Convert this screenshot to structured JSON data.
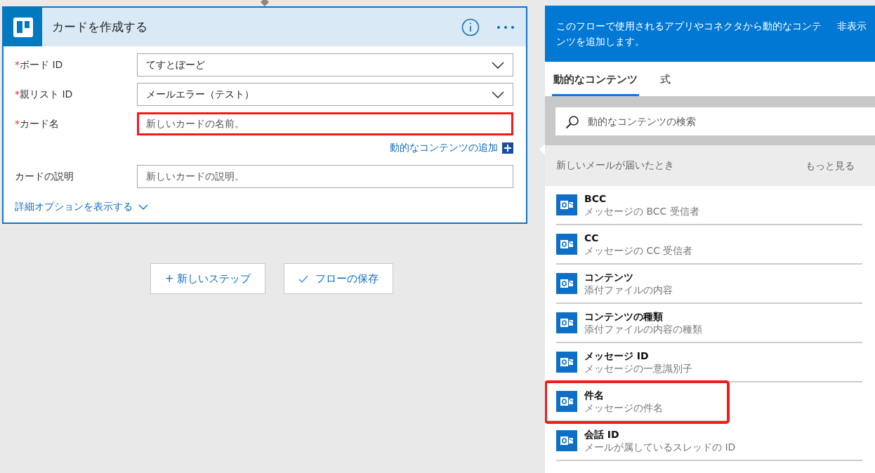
{
  "action_card": {
    "title": "カードを作成する",
    "fields": [
      {
        "label": "ボード ID",
        "required_mark": "*",
        "kind": "dropdown",
        "value": "てすとぼーど",
        "highlighted": false
      },
      {
        "label": "親リスト ID",
        "required_mark": "*",
        "kind": "dropdown",
        "value": "メールエラー（テスト）",
        "highlighted": false
      },
      {
        "label": "カード名",
        "required_mark": "*",
        "kind": "text",
        "placeholder": "新しいカードの名前。",
        "highlighted": true,
        "add_dynamic_link": "動的なコンテンツの追加"
      },
      {
        "label": "カードの説明",
        "kind": "text",
        "placeholder": "新しいカードの説明。",
        "highlighted": false
      }
    ],
    "advanced_link": "詳細オプションを表示する"
  },
  "buttons": [
    {
      "label": "+ 新しいステップ",
      "kind": "plain"
    },
    {
      "label": "フローの保存",
      "kind": "check"
    }
  ],
  "dynamic_panel": {
    "description": "このフローで使用されるアプリやコネクタから動的なコンテンツを追加します。",
    "hide_link": "非表示",
    "tabs": [
      {
        "label": "動的なコンテンツ",
        "selected": true
      },
      {
        "label": "式",
        "selected": false
      }
    ],
    "search": {
      "placeholder": "動的なコンテンツの検索"
    },
    "group": {
      "title": "新しいメールが届いたとき",
      "more_link": "もっと見る"
    },
    "items": [
      {
        "name": "BCC",
        "description": "メッセージの BCC 受信者",
        "highlighted": false
      },
      {
        "name": "CC",
        "description": "メッセージの CC 受信者",
        "highlighted": false
      },
      {
        "name": "コンテンツ",
        "description": "添付ファイルの内容",
        "highlighted": false
      },
      {
        "name": "コンテンツの種類",
        "description": "添付ファイルの内容の種類",
        "highlighted": false
      },
      {
        "name": "メッセージ ID",
        "description": "メッセージの一意識別子",
        "highlighted": false
      },
      {
        "name": "件名",
        "description": "メッセージの件名",
        "highlighted": true
      },
      {
        "name": "会話 ID",
        "description": "メールが属しているスレッドの ID",
        "highlighted": false
      }
    ]
  }
}
